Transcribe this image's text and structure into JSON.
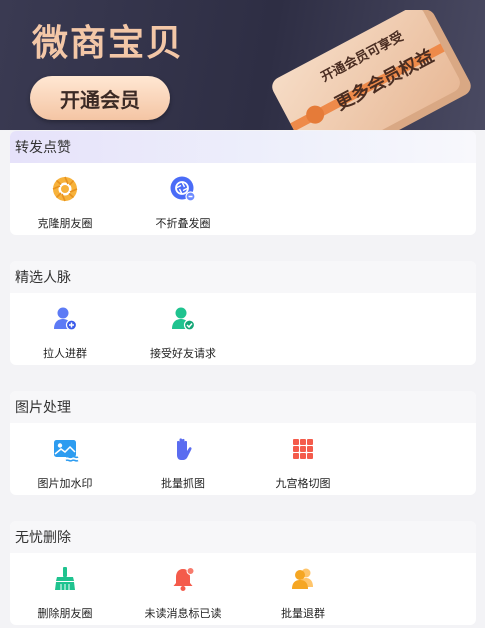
{
  "banner": {
    "title": "微商宝贝",
    "button_label": "开通会员",
    "card_line1": "开通会员可享受",
    "card_line2": "更多会员权益"
  },
  "sections": [
    {
      "title": "转发点赞",
      "items": [
        {
          "label": "克隆朋友圈",
          "icon": "aperture-icon"
        },
        {
          "label": "不折叠发圈",
          "icon": "camera-lens-icon"
        }
      ]
    },
    {
      "title": "精选人脉",
      "items": [
        {
          "label": "拉人进群",
          "icon": "add-user-icon"
        },
        {
          "label": "接受好友请求",
          "icon": "accept-user-icon"
        }
      ]
    },
    {
      "title": "图片处理",
      "items": [
        {
          "label": "图片加水印",
          "icon": "image-watermark-icon"
        },
        {
          "label": "批量抓图",
          "icon": "hand-grab-icon"
        },
        {
          "label": "九宫格切图",
          "icon": "grid-nine-icon"
        }
      ]
    },
    {
      "title": "无忧删除",
      "items": [
        {
          "label": "删除朋友圈",
          "icon": "broom-icon"
        },
        {
          "label": "未读消息标已读",
          "icon": "bell-icon"
        },
        {
          "label": "批量退群",
          "icon": "group-exit-icon"
        }
      ]
    }
  ],
  "colors": {
    "banner_bg": "#34344a",
    "banner_title": "#f3c7a7",
    "button_bg": "#f4c5a4",
    "orange": "#f5a623",
    "blue": "#4a6cf7",
    "green": "#1fc38f",
    "red": "#f45b4b"
  }
}
